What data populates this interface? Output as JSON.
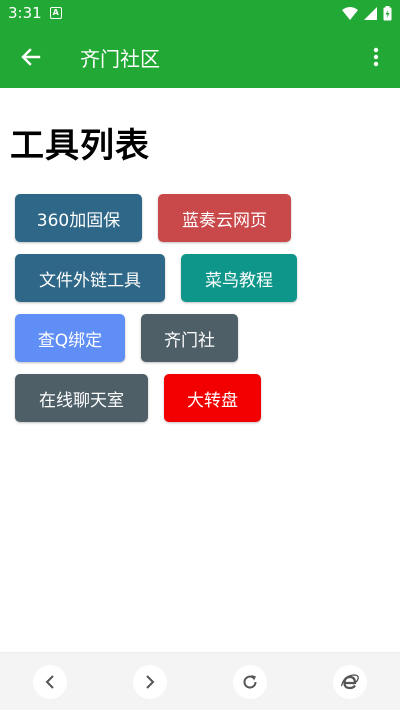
{
  "status_bar": {
    "time": "3:31",
    "badge": "A"
  },
  "app_bar": {
    "title": "齐门社区"
  },
  "page": {
    "title": "工具列表"
  },
  "tools": [
    {
      "label": "360加固保",
      "color": "#2e6787"
    },
    {
      "label": "蓝奏云网页",
      "color": "#c9484a"
    },
    {
      "label": "文件外链工具",
      "color": "#2e6787"
    },
    {
      "label": "菜鸟教程",
      "color": "#0e968a"
    },
    {
      "label": "查Q绑定",
      "color": "#5f8ef7"
    },
    {
      "label": "齐门社",
      "color": "#4e5f68"
    },
    {
      "label": "在线聊天室",
      "color": "#4e5f68"
    },
    {
      "label": "大转盘",
      "color": "#f20000"
    }
  ],
  "colors": {
    "app_bar": "#22a834",
    "bottom_bar": "#f4f4f4"
  },
  "bottom_nav": {
    "icons": [
      "back-icon",
      "forward-icon",
      "refresh-icon",
      "browser-icon"
    ]
  }
}
